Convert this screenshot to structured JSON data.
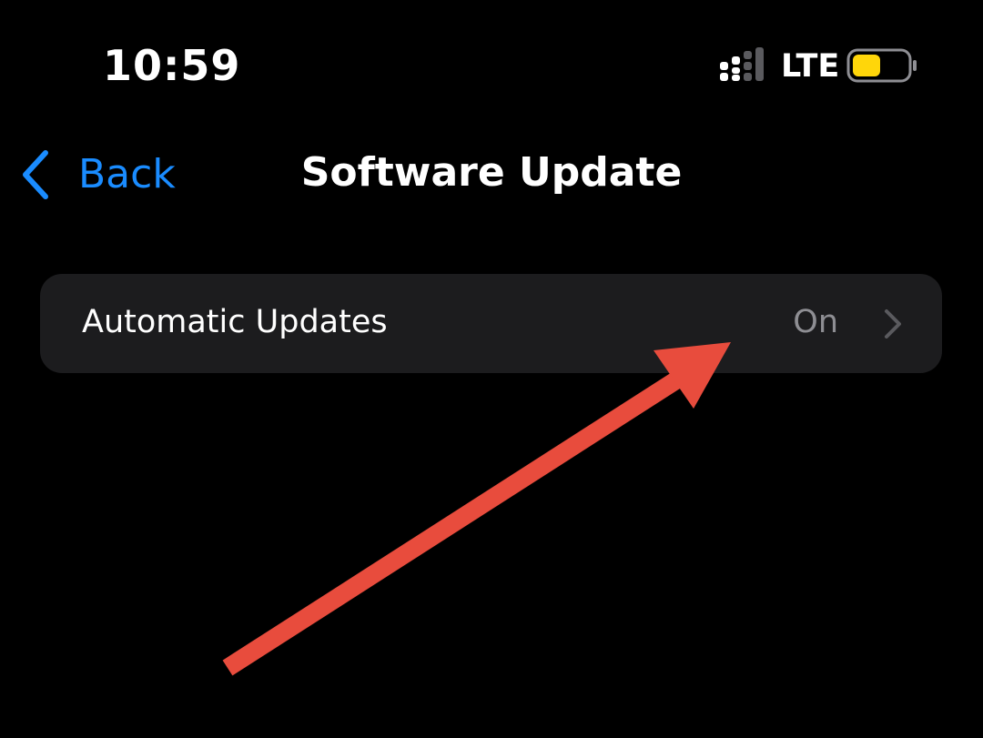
{
  "status_bar": {
    "time": "10:59",
    "network": "LTE",
    "signal_icon": "cellular-signal-icon",
    "battery_icon": "battery-icon",
    "battery_color": "#ffd60a"
  },
  "nav": {
    "back_label": "Back",
    "back_icon": "chevron-left-icon",
    "title": "Software Update"
  },
  "settings": {
    "automatic_updates": {
      "label": "Automatic Updates",
      "value": "On",
      "icon": "chevron-right-icon"
    }
  },
  "colors": {
    "background": "#000000",
    "group_background": "#1c1c1e",
    "accent_blue": "#1a8cff",
    "secondary_text": "#8e8e93",
    "annotation_red": "#e84c3d"
  },
  "annotation": {
    "icon": "red-arrow-annotation"
  }
}
